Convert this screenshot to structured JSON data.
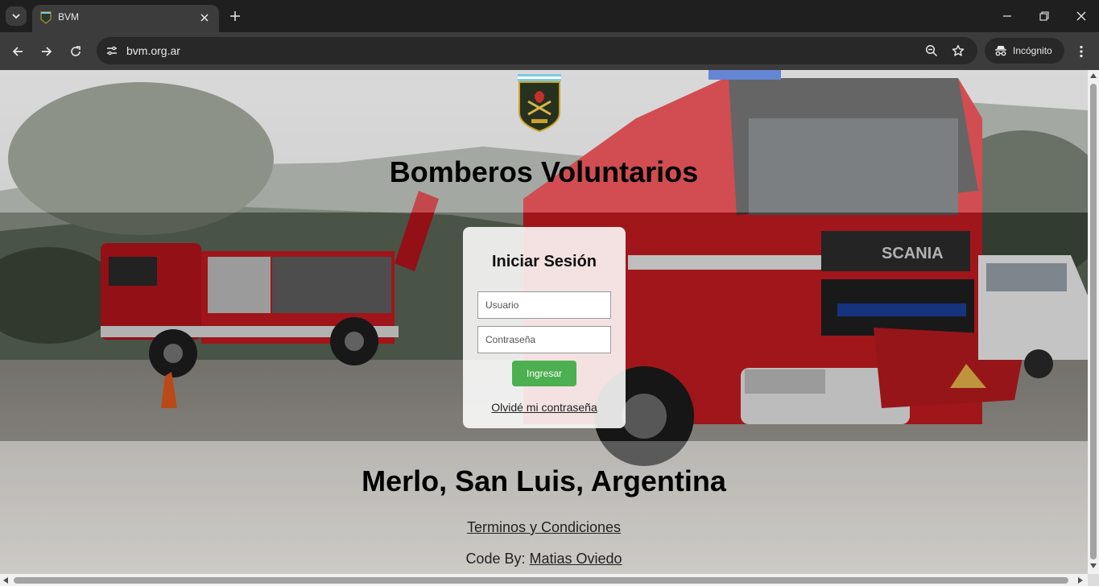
{
  "browser": {
    "tab_title": "BVM",
    "url": "bvm.org.ar",
    "incognito_label": "Incógnito"
  },
  "page": {
    "title": "Bomberos Voluntarios",
    "login": {
      "heading": "Iniciar Sesión",
      "username_placeholder": "Usuario",
      "password_placeholder": "Contraseña",
      "submit_label": "Ingresar",
      "forgot_link": "Olvidé mi contraseña"
    },
    "location": "Merlo, San Luis, Argentina",
    "terms_link": "Terminos y Condiciones",
    "credit_prefix": "Code By: ",
    "credit_author": "Matias Oviedo"
  },
  "colors": {
    "accent_button": "#4caf50",
    "chrome_bg": "#3c3c3c",
    "tabbar_bg": "#1f1f1f"
  }
}
